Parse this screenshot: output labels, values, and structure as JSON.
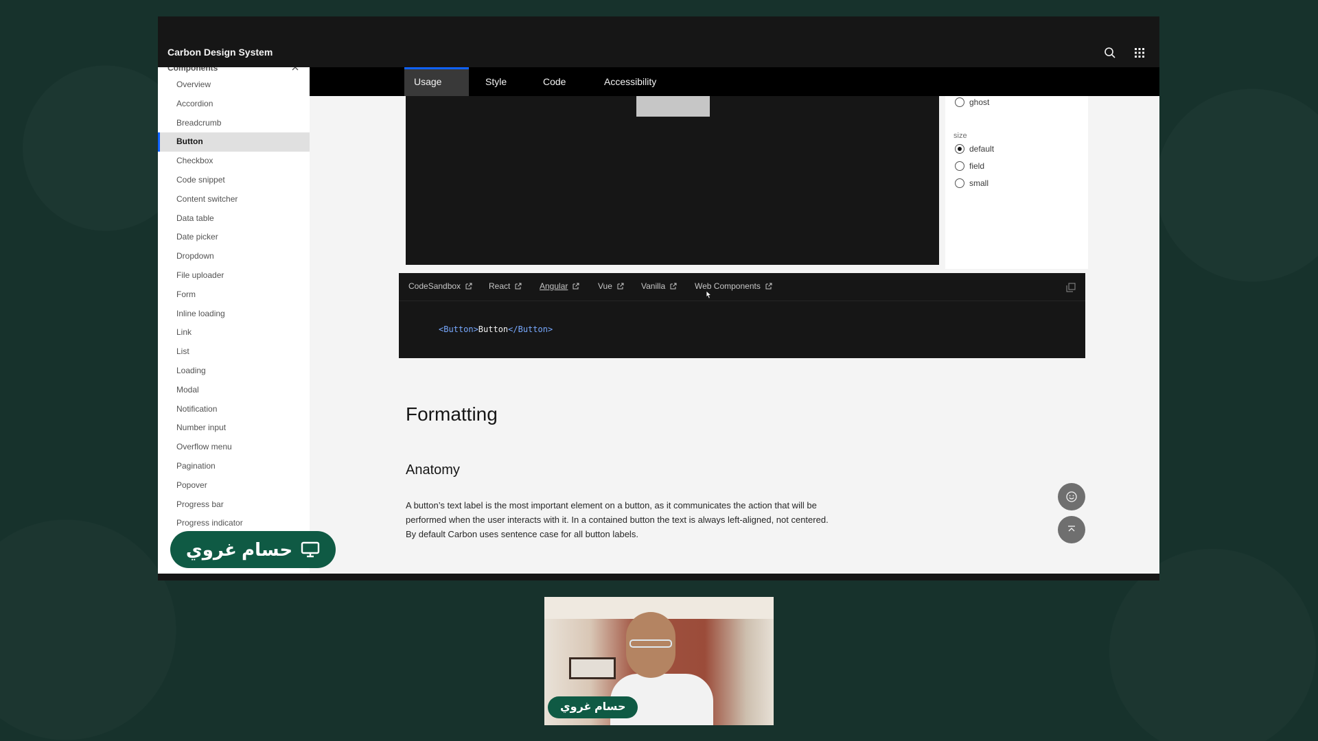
{
  "app": {
    "title": "Carbon Design System"
  },
  "sidebar": {
    "section_title": "Components",
    "items": [
      {
        "label": "Overview"
      },
      {
        "label": "Accordion"
      },
      {
        "label": "Breadcrumb"
      },
      {
        "label": "Button"
      },
      {
        "label": "Checkbox"
      },
      {
        "label": "Code snippet"
      },
      {
        "label": "Content switcher"
      },
      {
        "label": "Data table"
      },
      {
        "label": "Date picker"
      },
      {
        "label": "Dropdown"
      },
      {
        "label": "File uploader"
      },
      {
        "label": "Form"
      },
      {
        "label": "Inline loading"
      },
      {
        "label": "Link"
      },
      {
        "label": "List"
      },
      {
        "label": "Loading"
      },
      {
        "label": "Modal"
      },
      {
        "label": "Notification"
      },
      {
        "label": "Number input"
      },
      {
        "label": "Overflow menu"
      },
      {
        "label": "Pagination"
      },
      {
        "label": "Popover"
      },
      {
        "label": "Progress bar"
      },
      {
        "label": "Progress indicator"
      }
    ],
    "active_item": "Button"
  },
  "tabs": [
    {
      "label": "Usage"
    },
    {
      "label": "Style"
    },
    {
      "label": "Code"
    },
    {
      "label": "Accessibility"
    }
  ],
  "active_tab": "Usage",
  "knobs": {
    "kind_visible_option": "ghost",
    "size_label": "size",
    "size_options": [
      {
        "label": "default",
        "checked": true
      },
      {
        "label": "field",
        "checked": false
      },
      {
        "label": "small",
        "checked": false
      }
    ]
  },
  "code_panel": {
    "links": [
      {
        "label": "CodeSandbox"
      },
      {
        "label": "React"
      },
      {
        "label": "Angular"
      },
      {
        "label": "Vue"
      },
      {
        "label": "Vanilla"
      },
      {
        "label": "Web Components"
      }
    ],
    "code": {
      "open_tag": "<Button>",
      "text": "Button",
      "close_tag": "</Button>"
    }
  },
  "content": {
    "heading": "Formatting",
    "subheading": "Anatomy",
    "body": "A button’s text label is the most important element on a button, as it communicates the action that will be performed when the user interacts with it. In a contained button the text is always left-aligned, not centered. By default Carbon uses sentence case for all button labels."
  },
  "presenter": {
    "name": "حسام غروي"
  },
  "video": {
    "name": "حسام غروي"
  },
  "colors": {
    "accent": "#0f62fe",
    "badge_green": "#0f5a44",
    "background": "#17322c"
  }
}
